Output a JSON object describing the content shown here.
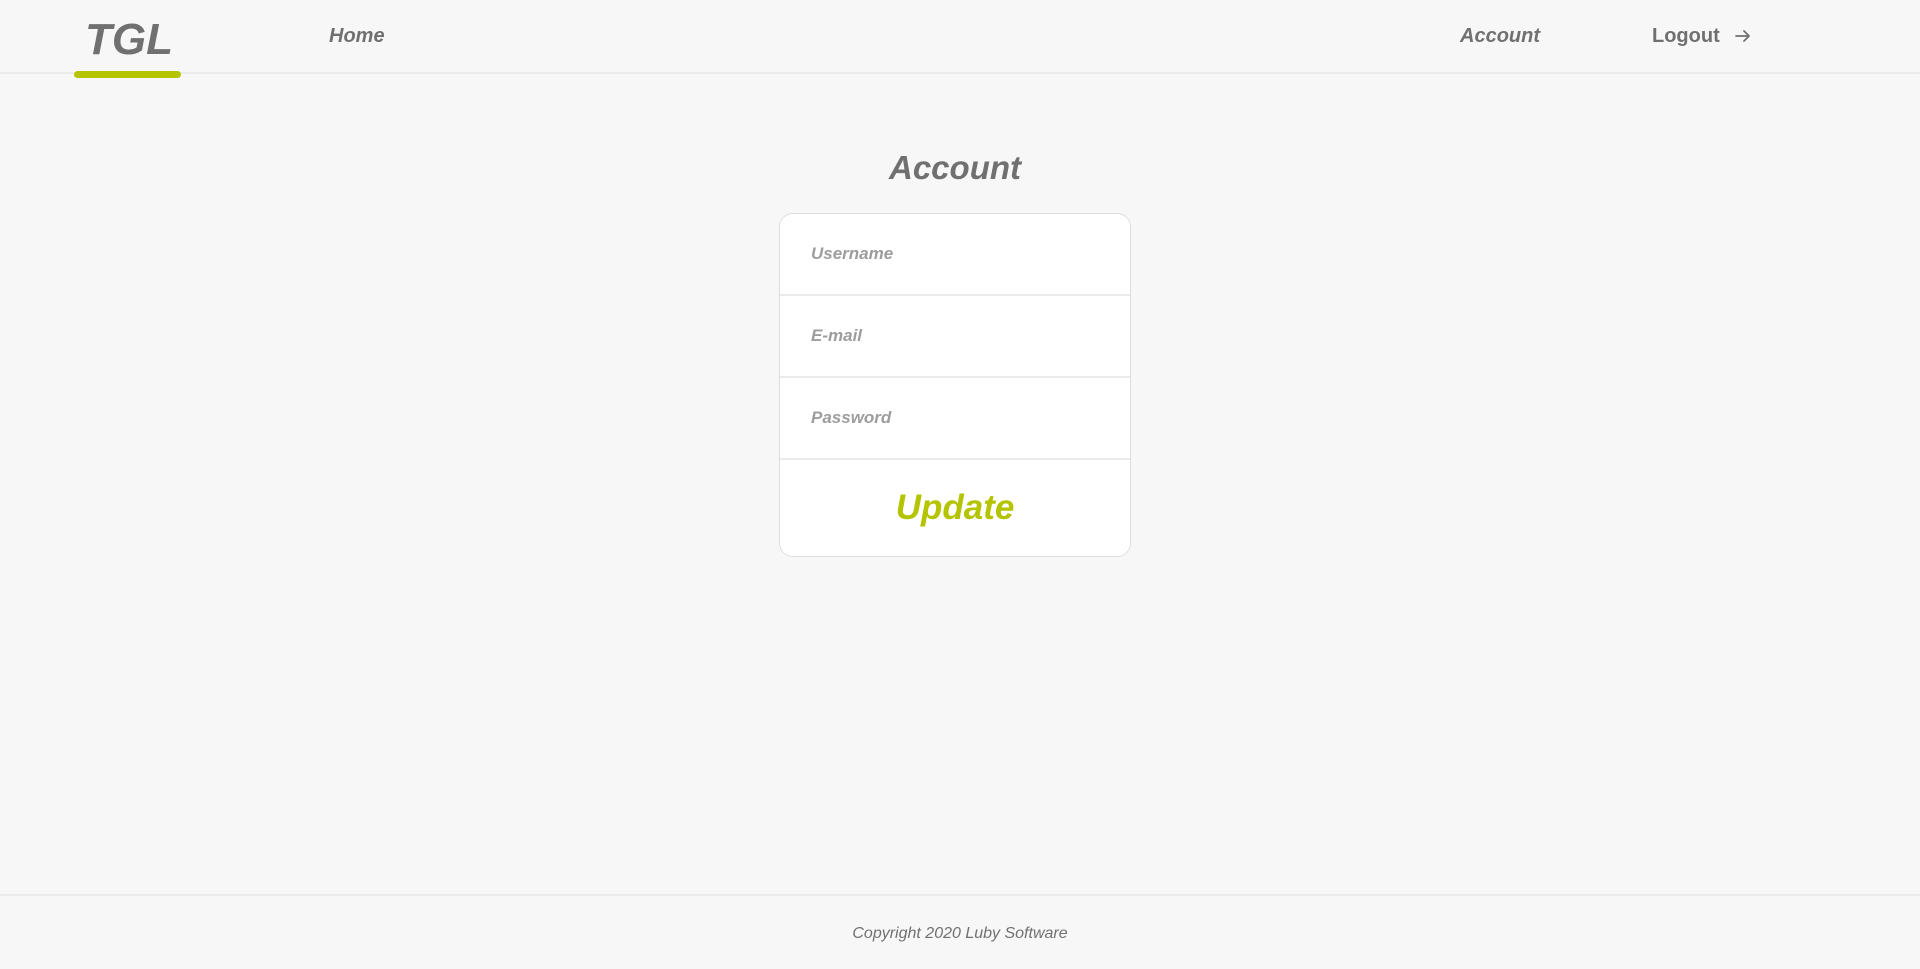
{
  "header": {
    "logo_text": "TGL",
    "nav": {
      "home_label": "Home",
      "account_label": "Account",
      "logout_label": "Logout"
    },
    "logout_icon": "arrow-right-icon"
  },
  "main": {
    "title": "Account",
    "form": {
      "username_placeholder": "Username",
      "email_placeholder": "E-mail",
      "password_placeholder": "Password",
      "update_label": "Update"
    }
  },
  "footer": {
    "copyright": "Copyright 2020 Luby Software"
  },
  "colors": {
    "background": "#F7F7F7",
    "text": "#707070",
    "accent": "#B5C401",
    "placeholder": "#9D9D9D",
    "divider": "#EBEBEB",
    "card": "#FFFFFF"
  }
}
